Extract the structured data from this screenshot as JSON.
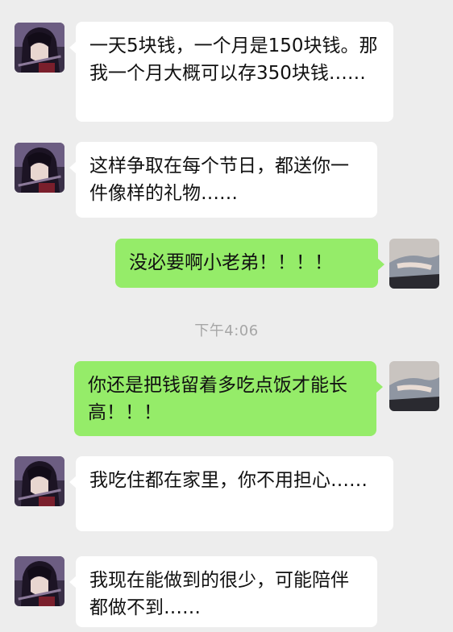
{
  "conversation": {
    "messages": [
      {
        "side": "in",
        "avatar": "anime-character-avatar",
        "text": "一天5块钱，一个月是150块钱。那我一个月大概可以存350块钱……"
      },
      {
        "side": "in",
        "avatar": "anime-character-avatar",
        "text": "这样争取在每个节日，都送你一件像样的礼物……"
      },
      {
        "side": "out",
        "avatar": "user-photo-avatar",
        "text": "没必要啊小老弟！！！！"
      },
      {
        "side": "out",
        "avatar": "user-photo-avatar",
        "text": "你还是把钱留着多吃点饭才能长高！！！"
      },
      {
        "side": "in",
        "avatar": "anime-character-avatar",
        "text": "我吃住都在家里，你不用担心……"
      },
      {
        "side": "in",
        "avatar": "anime-character-avatar",
        "text": "我现在能做到的很少，可能陪伴都做不到……"
      }
    ],
    "timestamp": "下午4:06"
  },
  "colors": {
    "background": "#ededed",
    "incoming_bubble": "#ffffff",
    "outgoing_bubble": "#95ec69",
    "timestamp_text": "#a6a6a6"
  }
}
